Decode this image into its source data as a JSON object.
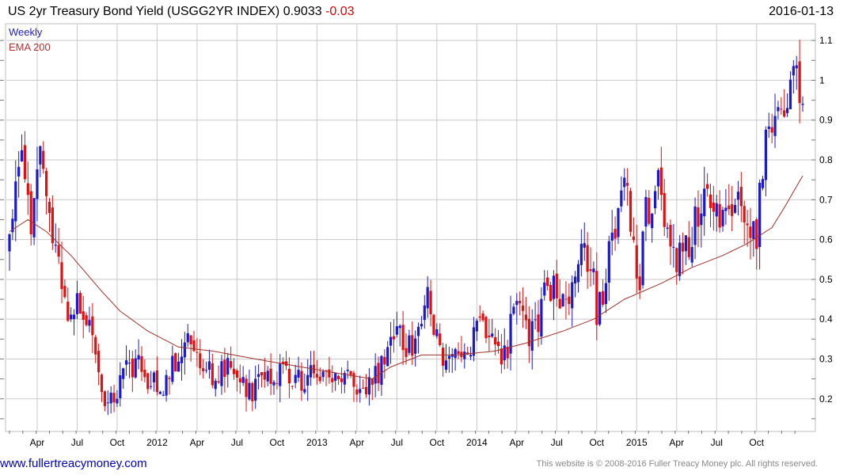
{
  "header": {
    "title": "US 2yr Treasury Bond Yield (USGG2YR INDEX)",
    "last": "0.9033",
    "change": "-0.03",
    "date": "2016-01-13"
  },
  "footer": {
    "site": "www.fullertreacymoney.com",
    "copyright": "This website is © 2008-2016 Fuller Treacy Money plc. All rights reserved."
  },
  "chart_data": {
    "type": "candlestick",
    "legend": [
      {
        "name": "Weekly",
        "color": "#2020c0"
      },
      {
        "name": "EMA 200",
        "color": "#b03030"
      }
    ],
    "legend_position": "top-left",
    "ylim": [
      0.12,
      1.14
    ],
    "yticks": [
      0.2,
      0.3,
      0.4,
      0.5,
      0.6,
      0.7,
      0.8,
      0.9,
      1.0,
      1.1
    ],
    "ytick_labels": [
      "0.2",
      "0.3",
      "0.4",
      "0.5",
      "0.6",
      "0.7",
      "0.8",
      "0.9",
      "1",
      "1.1"
    ],
    "xticks": [
      {
        "label": "Apr",
        "week": 9
      },
      {
        "label": "Jul",
        "week": 22
      },
      {
        "label": "Oct",
        "week": 35
      },
      {
        "label": "2012",
        "week": 48
      },
      {
        "label": "Apr",
        "week": 61
      },
      {
        "label": "Jul",
        "week": 74
      },
      {
        "label": "Oct",
        "week": 87
      },
      {
        "label": "2013",
        "week": 100
      },
      {
        "label": "Apr",
        "week": 113
      },
      {
        "label": "Jul",
        "week": 126
      },
      {
        "label": "Oct",
        "week": 139
      },
      {
        "label": "2014",
        "week": 152
      },
      {
        "label": "Apr",
        "week": 165
      },
      {
        "label": "Jul",
        "week": 178
      },
      {
        "label": "Oct",
        "week": 191
      },
      {
        "label": "2015",
        "week": 204
      },
      {
        "label": "Apr",
        "week": 217
      },
      {
        "label": "Jul",
        "week": 230
      },
      {
        "label": "Oct",
        "week": 243
      }
    ],
    "weeks": 258,
    "up_color": "#1a1acc",
    "down_color": "#e01010",
    "grid": true,
    "ema_anchors": [
      [
        0,
        0.62
      ],
      [
        6,
        0.65
      ],
      [
        12,
        0.62
      ],
      [
        20,
        0.56
      ],
      [
        30,
        0.47
      ],
      [
        36,
        0.42
      ],
      [
        45,
        0.37
      ],
      [
        55,
        0.33
      ],
      [
        66,
        0.32
      ],
      [
        80,
        0.3
      ],
      [
        95,
        0.28
      ],
      [
        110,
        0.26
      ],
      [
        118,
        0.25
      ],
      [
        124,
        0.28
      ],
      [
        134,
        0.31
      ],
      [
        145,
        0.31
      ],
      [
        158,
        0.32
      ],
      [
        168,
        0.34
      ],
      [
        180,
        0.37
      ],
      [
        190,
        0.4
      ],
      [
        200,
        0.45
      ],
      [
        212,
        0.49
      ],
      [
        222,
        0.53
      ],
      [
        232,
        0.56
      ],
      [
        240,
        0.59
      ],
      [
        248,
        0.63
      ],
      [
        252,
        0.68
      ],
      [
        258,
        0.76
      ]
    ],
    "close_anchors": [
      [
        0,
        0.57
      ],
      [
        2,
        0.7
      ],
      [
        4,
        0.8
      ],
      [
        7,
        0.62
      ],
      [
        10,
        0.82
      ],
      [
        13,
        0.63
      ],
      [
        16,
        0.53
      ],
      [
        19,
        0.42
      ],
      [
        22,
        0.43
      ],
      [
        24,
        0.38
      ],
      [
        27,
        0.35
      ],
      [
        30,
        0.2
      ],
      [
        34,
        0.21
      ],
      [
        38,
        0.27
      ],
      [
        42,
        0.29
      ],
      [
        46,
        0.24
      ],
      [
        50,
        0.24
      ],
      [
        54,
        0.3
      ],
      [
        58,
        0.37
      ],
      [
        61,
        0.3
      ],
      [
        64,
        0.26
      ],
      [
        68,
        0.27
      ],
      [
        72,
        0.29
      ],
      [
        75,
        0.27
      ],
      [
        78,
        0.21
      ],
      [
        82,
        0.24
      ],
      [
        86,
        0.26
      ],
      [
        90,
        0.27
      ],
      [
        94,
        0.25
      ],
      [
        98,
        0.26
      ],
      [
        102,
        0.26
      ],
      [
        106,
        0.25
      ],
      [
        110,
        0.25
      ],
      [
        114,
        0.22
      ],
      [
        116,
        0.22
      ],
      [
        118,
        0.24
      ],
      [
        120,
        0.26
      ],
      [
        123,
        0.35
      ],
      [
        126,
        0.4
      ],
      [
        128,
        0.33
      ],
      [
        131,
        0.32
      ],
      [
        134,
        0.38
      ],
      [
        136,
        0.46
      ],
      [
        138,
        0.35
      ],
      [
        141,
        0.32
      ],
      [
        144,
        0.3
      ],
      [
        147,
        0.3
      ],
      [
        150,
        0.34
      ],
      [
        153,
        0.4
      ],
      [
        156,
        0.39
      ],
      [
        159,
        0.31
      ],
      [
        162,
        0.33
      ],
      [
        164,
        0.45
      ],
      [
        166,
        0.42
      ],
      [
        169,
        0.34
      ],
      [
        172,
        0.41
      ],
      [
        175,
        0.48
      ],
      [
        178,
        0.46
      ],
      [
        181,
        0.43
      ],
      [
        184,
        0.52
      ],
      [
        187,
        0.56
      ],
      [
        189,
        0.55
      ],
      [
        191,
        0.42
      ],
      [
        193,
        0.45
      ],
      [
        195,
        0.56
      ],
      [
        197,
        0.65
      ],
      [
        199,
        0.7
      ],
      [
        201,
        0.74
      ],
      [
        203,
        0.56
      ],
      [
        205,
        0.48
      ],
      [
        207,
        0.7
      ],
      [
        209,
        0.62
      ],
      [
        211,
        0.74
      ],
      [
        213,
        0.66
      ],
      [
        215,
        0.58
      ],
      [
        217,
        0.54
      ],
      [
        219,
        0.57
      ],
      [
        221,
        0.6
      ],
      [
        223,
        0.64
      ],
      [
        225,
        0.7
      ],
      [
        227,
        0.68
      ],
      [
        229,
        0.63
      ],
      [
        231,
        0.67
      ],
      [
        233,
        0.7
      ],
      [
        235,
        0.68
      ],
      [
        237,
        0.7
      ],
      [
        239,
        0.67
      ],
      [
        241,
        0.6
      ],
      [
        243,
        0.6
      ],
      [
        244,
        0.72
      ],
      [
        246,
        0.85
      ],
      [
        248,
        0.88
      ],
      [
        250,
        0.9
      ],
      [
        252,
        0.92
      ],
      [
        254,
        1.0
      ],
      [
        256,
        1.05
      ],
      [
        257,
        0.93
      ],
      [
        258,
        0.9
      ]
    ],
    "random_seed": 20160113
  }
}
